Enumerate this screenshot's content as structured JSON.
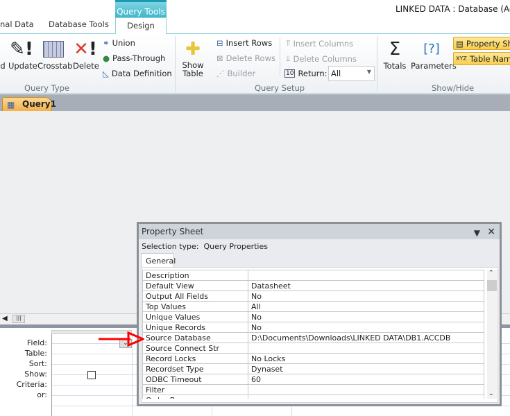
{
  "window": {
    "title": "LINKED DATA : Database (Acces"
  },
  "ribbon_tabs": [
    {
      "label": "nal Data"
    },
    {
      "label": "Database Tools"
    }
  ],
  "context_tab": {
    "header": "Query Tools",
    "tab": "Design"
  },
  "query_type": {
    "label": "Query Type",
    "buttons": [
      {
        "label": "d"
      },
      {
        "label": "Update"
      },
      {
        "label": "Crosstab"
      },
      {
        "label": "Delete"
      }
    ],
    "small": [
      {
        "label": "Union"
      },
      {
        "label": "Pass-Through"
      },
      {
        "label": "Data Definition"
      }
    ]
  },
  "query_setup": {
    "label": "Query Setup",
    "show_table": "Show\nTable",
    "insert_rows": "Insert Rows",
    "delete_rows": "Delete Rows",
    "builder": "Builder",
    "insert_columns": "Insert Columns",
    "delete_columns": "Delete Columns",
    "return_label": "Return:",
    "return_value": "All"
  },
  "show_hide": {
    "label": "Show/Hide",
    "totals": "Totals",
    "parameters": "Parameters",
    "property_sheet": "Property Sheet",
    "table_names": "Table Names"
  },
  "document_tab": {
    "label": "Query1"
  },
  "grid": {
    "row_labels": [
      "Field:",
      "Table:",
      "Sort:",
      "Show:",
      "Criteria:",
      "or:"
    ]
  },
  "property_sheet": {
    "title": "Property Sheet",
    "selection_label": "Selection type:",
    "selection_value": "Query Properties",
    "tab": "General",
    "rows": [
      {
        "name": "Description",
        "value": ""
      },
      {
        "name": "Default View",
        "value": "Datasheet"
      },
      {
        "name": "Output All Fields",
        "value": "No"
      },
      {
        "name": "Top Values",
        "value": "All"
      },
      {
        "name": "Unique Values",
        "value": "No"
      },
      {
        "name": "Unique Records",
        "value": "No"
      },
      {
        "name": "Source Database",
        "value": "D:\\Documents\\Downloads\\LINKED DATA\\DB1.ACCDB"
      },
      {
        "name": "Source Connect Str",
        "value": ""
      },
      {
        "name": "Record Locks",
        "value": "No Locks"
      },
      {
        "name": "Recordset Type",
        "value": "Dynaset"
      },
      {
        "name": "ODBC Timeout",
        "value": "60"
      },
      {
        "name": "Filter",
        "value": ""
      },
      {
        "name": "Order By",
        "value": ""
      }
    ]
  },
  "colors": {
    "accent": "#3fb7cc",
    "highlight": "#f8cf4e",
    "annotation_arrow": "#ff0000"
  }
}
